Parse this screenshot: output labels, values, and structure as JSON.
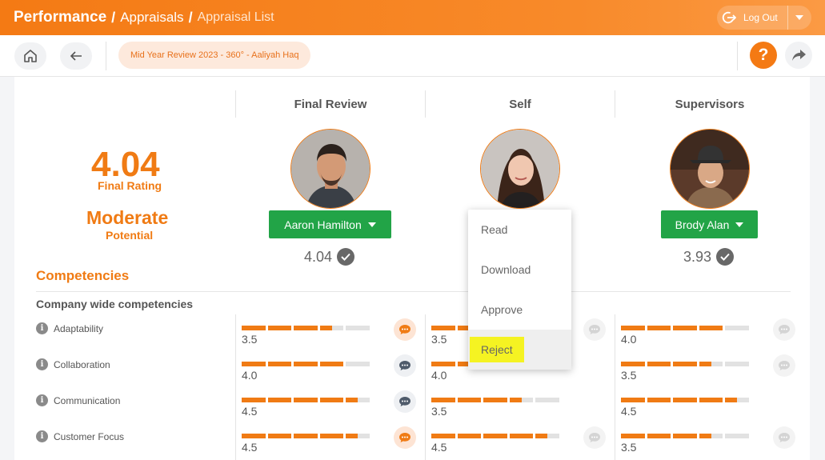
{
  "header": {
    "crumb_main": "Performance",
    "crumb_mid": "Appraisals",
    "crumb_last": "Appraisal List",
    "logout_label": "Log Out"
  },
  "toolbar": {
    "chip_label": "Mid Year Review 2023 - 360° - Aaliyah Haq",
    "help_label": "?"
  },
  "columns": [
    {
      "title": "Final Review",
      "person": "Aaron Hamilton",
      "score": "4.04"
    },
    {
      "title": "Self",
      "person": "",
      "score": ""
    },
    {
      "title": "Supervisors",
      "person": "Brody Alan",
      "score": "3.93"
    }
  ],
  "summary": {
    "final_rating_value": "4.04",
    "final_rating_label": "Final Rating",
    "potential_value": "Moderate",
    "potential_label": "Potential"
  },
  "section": {
    "title": "Competencies",
    "subtitle": "Company wide competencies"
  },
  "competencies": [
    {
      "name": "Adaptability",
      "ratings": [
        {
          "value": "3.5",
          "fill": 0.7,
          "comment": "orange"
        },
        {
          "value": "3.5",
          "fill": 0.7,
          "comment": "faded"
        },
        {
          "value": "4.0",
          "fill": 0.8,
          "comment": "faded"
        }
      ]
    },
    {
      "name": "Collaboration",
      "ratings": [
        {
          "value": "4.0",
          "fill": 0.8,
          "comment": "dark"
        },
        {
          "value": "4.0",
          "fill": 0.8,
          "comment": "none"
        },
        {
          "value": "3.5",
          "fill": 0.7,
          "comment": "faded"
        }
      ]
    },
    {
      "name": "Communication",
      "ratings": [
        {
          "value": "4.5",
          "fill": 0.9,
          "comment": "dark"
        },
        {
          "value": "3.5",
          "fill": 0.7,
          "comment": "none"
        },
        {
          "value": "4.5",
          "fill": 0.9,
          "comment": "none"
        }
      ]
    },
    {
      "name": "Customer Focus",
      "ratings": [
        {
          "value": "4.5",
          "fill": 0.9,
          "comment": "orange"
        },
        {
          "value": "4.5",
          "fill": 0.9,
          "comment": "faded"
        },
        {
          "value": "3.5",
          "fill": 0.7,
          "comment": "faded"
        }
      ]
    }
  ],
  "menu": {
    "items": [
      "Read",
      "Download",
      "Approve",
      "Reject"
    ],
    "active_index": 3
  },
  "colors": {
    "brand_orange": "#f07b14",
    "green": "#22a447",
    "highlight": "#f5f322"
  }
}
